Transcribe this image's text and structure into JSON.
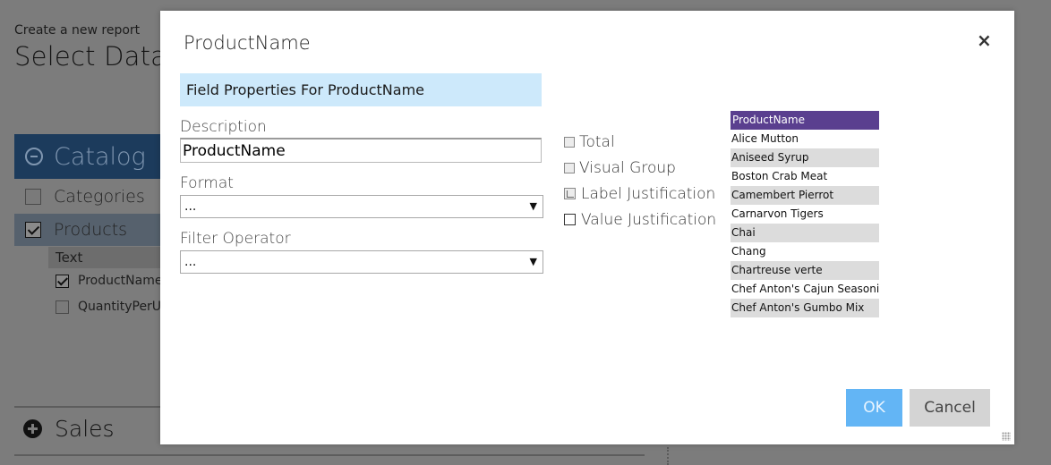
{
  "background": {
    "subtitle": "Create a new report",
    "title": "Select Data",
    "catalog_label": "Catalog",
    "categories_label": "Categories",
    "products_label": "Products",
    "text_header": "Text",
    "fields": [
      "ProductName",
      "QuantityPerU"
    ],
    "sales_label": "Sales"
  },
  "modal": {
    "title": "ProductName",
    "banner": "Field Properties For ProductName",
    "description_label": "Description",
    "description_value": "ProductName",
    "format_label": "Format",
    "format_value": "...",
    "filter_label": "Filter Operator",
    "filter_value": "...",
    "options": {
      "total": "Total",
      "visual_group": "Visual Group",
      "label_just": "Label Justification",
      "value_just": "Value Justification"
    },
    "preview": {
      "header": "ProductName",
      "rows": [
        "Alice Mutton",
        "Aniseed Syrup",
        "Boston Crab Meat",
        "Camembert Pierrot",
        "Carnarvon Tigers",
        "Chai",
        "Chang",
        "Chartreuse verte",
        "Chef Anton's Cajun Seasoning",
        "Chef Anton's Gumbo Mix"
      ]
    },
    "ok_label": "OK",
    "cancel_label": "Cancel",
    "close_glyph": "×"
  },
  "colors": {
    "overlay": "#7c7c7c",
    "banner": "#cde9fb",
    "preview_header": "#5a3f8f",
    "ok_button": "#63b5f5",
    "cancel_button": "#d4d4d4"
  }
}
